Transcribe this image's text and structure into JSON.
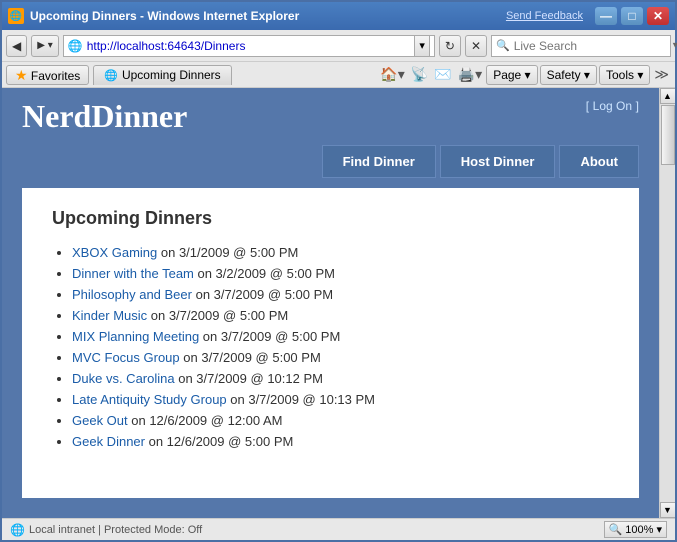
{
  "window": {
    "title": "Upcoming Dinners - Windows Internet Explorer",
    "send_feedback": "Send Feedback",
    "min_btn": "—",
    "max_btn": "□",
    "close_btn": "✕"
  },
  "toolbar": {
    "back_btn": "◀",
    "forward_btn": "▶",
    "address": "http://localhost:64643/Dinners",
    "refresh_btn": "↻",
    "stop_btn": "✕",
    "search_placeholder": "Live Search",
    "search_label": "Search"
  },
  "favorites_bar": {
    "favorites_btn": "Favorites",
    "tab_label": "Upcoming Dinners",
    "tab_icon": "🌐",
    "page_btn": "Page ▾",
    "safety_btn": "Safety ▾",
    "tools_btn": "Tools ▾"
  },
  "page": {
    "site_title": "NerdDinner",
    "log_on_open": "[",
    "log_on_label": "Log On",
    "log_on_close": "]",
    "nav": {
      "find_dinner": "Find Dinner",
      "host_dinner": "Host Dinner",
      "about": "About"
    },
    "section_title": "Upcoming Dinners",
    "dinners": [
      {
        "title": "XBOX Gaming",
        "time": " on 3/1/2009 @ 5:00 PM"
      },
      {
        "title": "Dinner with the Team",
        "time": " on 3/2/2009 @ 5:00 PM"
      },
      {
        "title": "Philosophy and Beer",
        "time": " on 3/7/2009 @ 5:00 PM"
      },
      {
        "title": "Kinder Music",
        "time": " on 3/7/2009 @ 5:00 PM"
      },
      {
        "title": "MIX Planning Meeting",
        "time": " on 3/7/2009 @ 5:00 PM"
      },
      {
        "title": "MVC Focus Group",
        "time": " on 3/7/2009 @ 5:00 PM"
      },
      {
        "title": "Duke vs. Carolina",
        "time": " on 3/7/2009 @ 10:12 PM"
      },
      {
        "title": "Late Antiquity Study Group",
        "time": " on 3/7/2009 @ 10:13 PM"
      },
      {
        "title": "Geek Out",
        "time": " on 12/6/2009 @ 12:00 AM"
      },
      {
        "title": "Geek Dinner",
        "time": " on 12/6/2009 @ 5:00 PM"
      }
    ]
  },
  "status_bar": {
    "zone": "Local intranet | Protected Mode: Off",
    "zoom": "100%"
  }
}
